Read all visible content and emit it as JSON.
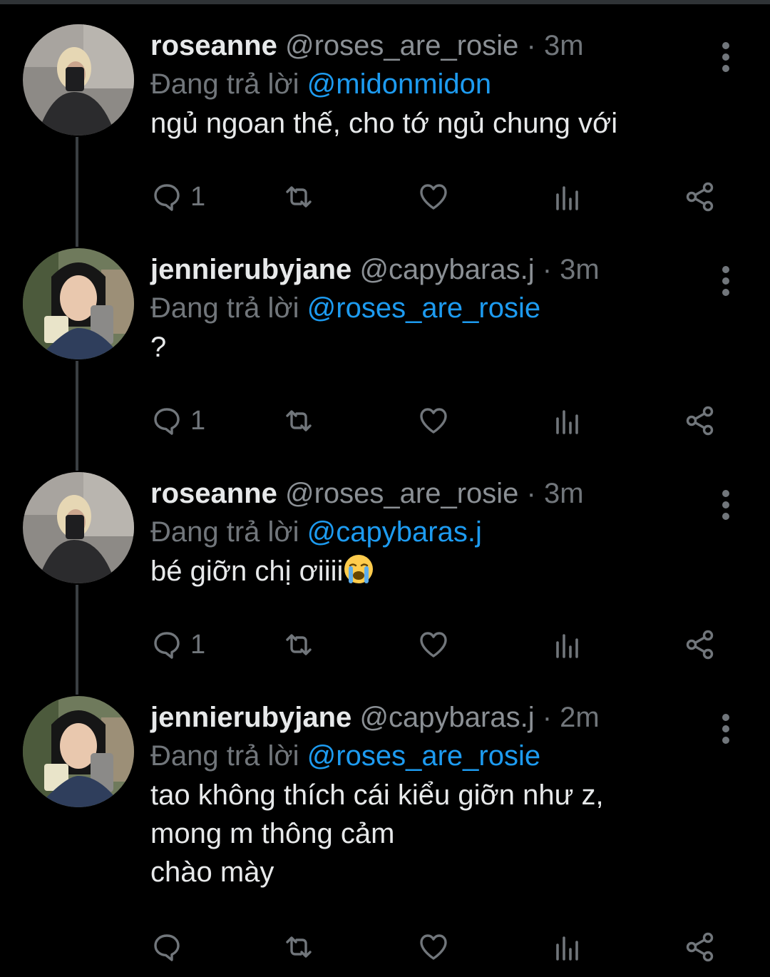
{
  "colors": {
    "background": "#000000",
    "text_primary": "#e7e9ea",
    "text_secondary": "#71767b",
    "mention": "#1d9bf0",
    "thread_line": "#3a3f43"
  },
  "icons": {
    "reply": "speech-bubble-icon",
    "retweet": "retweet-icon",
    "like": "heart-icon",
    "views": "bar-chart-icon",
    "share": "share-icon",
    "more": "vertical-ellipsis-icon"
  },
  "tweets": [
    {
      "name": "roseanne",
      "handle": "@roses_are_rosie",
      "time": "· 3m",
      "replying_prefix": "Đang trả lời",
      "replying_to": "@midonmidon",
      "text": "ngủ ngoan thế, cho tớ ngủ chung với",
      "reply_count": "1"
    },
    {
      "name": "jennierubyjane",
      "handle": "@capybaras.j",
      "time": "· 3m",
      "replying_prefix": "Đang trả lời",
      "replying_to": "@roses_are_rosie",
      "text": "?",
      "reply_count": "1"
    },
    {
      "name": "roseanne",
      "handle": "@roses_are_rosie",
      "time": "· 3m",
      "replying_prefix": "Đang trả lời",
      "replying_to": "@capybaras.j",
      "text": "bé giỡn chị ơiiii",
      "emoji": "loudly-crying-face",
      "reply_count": "1"
    },
    {
      "name": "jennierubyjane",
      "handle": "@capybaras.j",
      "time": "· 2m",
      "replying_prefix": "Đang trả lời",
      "replying_to": "@roses_are_rosie",
      "text": "tao không thích cái kiểu giỡn như z,\nmong m thông cảm\nchào mày",
      "reply_count": ""
    }
  ]
}
